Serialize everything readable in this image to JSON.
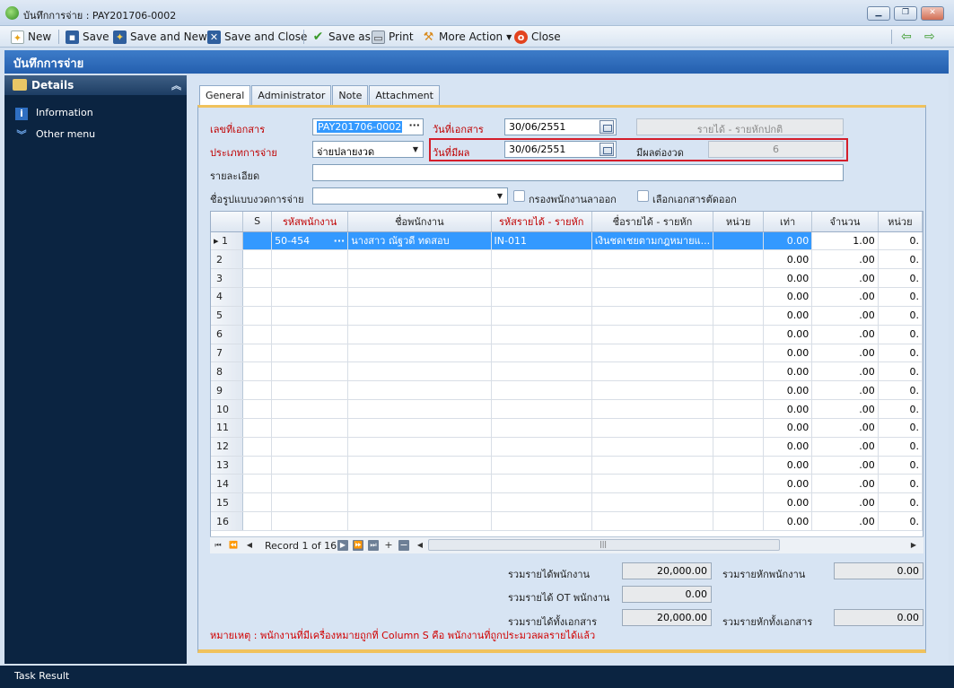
{
  "window": {
    "title": "บันทึกการจ่าย : PAY201706-0002",
    "controls": {
      "minimize": "▁",
      "restore": "❐",
      "close": "✕"
    }
  },
  "toolbar": {
    "new": "New",
    "save": "Save",
    "save_and_new": "Save and New",
    "save_and_close": "Save and Close",
    "save_as": "Save as",
    "print": "Print",
    "more_action": "More Action",
    "close": "Close"
  },
  "form_header": "บันทึกการจ่าย",
  "sidebar": {
    "header": "Details",
    "items": [
      {
        "label": "Information",
        "icon": "info-icon"
      },
      {
        "label": "Other menu",
        "icon": "double-chevron-down-icon"
      }
    ]
  },
  "tabs": [
    "General",
    "Administrator",
    "Note",
    "Attachment"
  ],
  "form": {
    "doc_no_label": "เลขที่เอกสาร",
    "doc_no_value": "PAY201706-0002",
    "doc_date_label": "วันที่เอกสาร",
    "doc_date_value": "30/06/2551",
    "income_type_value": "รายได้ - รายหักปกติ",
    "pay_type_label": "ประเภทการจ่าย",
    "pay_type_value": "จ่ายปลายงวด",
    "effective_date_label": "วันที่มีผล",
    "effective_date_value": "30/06/2551",
    "periods_label": "มีผลต่องวด",
    "periods_value": "6",
    "detail_label": "รายละเอียด",
    "detail_value": "",
    "pay_format_label": "ชื่อรูปแบบงวดการจ่าย",
    "pay_format_value": "",
    "filter_resigned_label": "กรองพนักงานลาออก",
    "select_cut_docs_label": "เลือกเอกสารตัดออก"
  },
  "grid": {
    "columns": [
      "S",
      "รหัสพนักงาน",
      "ชื่อพนักงาน",
      "รหัสรายได้ - รายหัก",
      "ชื่อรายได้ - รายหัก",
      "หน่วย",
      "เท่า",
      "จำนวน",
      "หน่วย"
    ],
    "rows": [
      {
        "no": "1",
        "emp_code": "50-454",
        "emp_name": "นางสาว ณัฐวดี ทดสอบ",
        "code": "IN-011",
        "name": "เงินชดเชยตามกฎหมายแ...",
        "unit": "",
        "times": "0.00",
        "amount": "1.00",
        "unit2": "0."
      },
      {
        "no": "2",
        "times": "0.00",
        "amount": ".00",
        "unit2": "0."
      },
      {
        "no": "3",
        "times": "0.00",
        "amount": ".00",
        "unit2": "0."
      },
      {
        "no": "4",
        "times": "0.00",
        "amount": ".00",
        "unit2": "0."
      },
      {
        "no": "5",
        "times": "0.00",
        "amount": ".00",
        "unit2": "0."
      },
      {
        "no": "6",
        "times": "0.00",
        "amount": ".00",
        "unit2": "0."
      },
      {
        "no": "7",
        "times": "0.00",
        "amount": ".00",
        "unit2": "0."
      },
      {
        "no": "8",
        "times": "0.00",
        "amount": ".00",
        "unit2": "0."
      },
      {
        "no": "9",
        "times": "0.00",
        "amount": ".00",
        "unit2": "0."
      },
      {
        "no": "10",
        "times": "0.00",
        "amount": ".00",
        "unit2": "0."
      },
      {
        "no": "11",
        "times": "0.00",
        "amount": ".00",
        "unit2": "0."
      },
      {
        "no": "12",
        "times": "0.00",
        "amount": ".00",
        "unit2": "0."
      },
      {
        "no": "13",
        "times": "0.00",
        "amount": ".00",
        "unit2": "0."
      },
      {
        "no": "14",
        "times": "0.00",
        "amount": ".00",
        "unit2": "0."
      },
      {
        "no": "15",
        "times": "0.00",
        "amount": ".00",
        "unit2": "0."
      },
      {
        "no": "16",
        "times": "0.00",
        "amount": ".00",
        "unit2": "0."
      }
    ],
    "record_text": "Record 1 of 16"
  },
  "summary": {
    "emp_income_label": "รวมรายได้พนักงาน",
    "emp_income_value": "20,000.00",
    "emp_deduct_label": "รวมรายหักพนักงาน",
    "emp_deduct_value": "0.00",
    "ot_label": "รวมรายได้ OT พนักงาน",
    "ot_value": "0.00",
    "doc_income_label": "รวมรายได้ทั้งเอกสาร",
    "doc_income_value": "20,000.00",
    "doc_deduct_label": "รวมรายหักทั้งเอกสาร",
    "doc_deduct_value": "0.00"
  },
  "note": "หมายเหตุ : พนักงานที่มีเครื่องหมายถูกที่ Column S คือ พนักงานที่ถูกประมวลผลรายได้แล้ว",
  "status_bar": "Task Result",
  "colors": {
    "header_blue": "#245fae",
    "sidebar_navy": "#0b2441",
    "selection": "#3399ff",
    "highlight_red": "#d41e2b",
    "tab_accent": "#f0c25c"
  }
}
